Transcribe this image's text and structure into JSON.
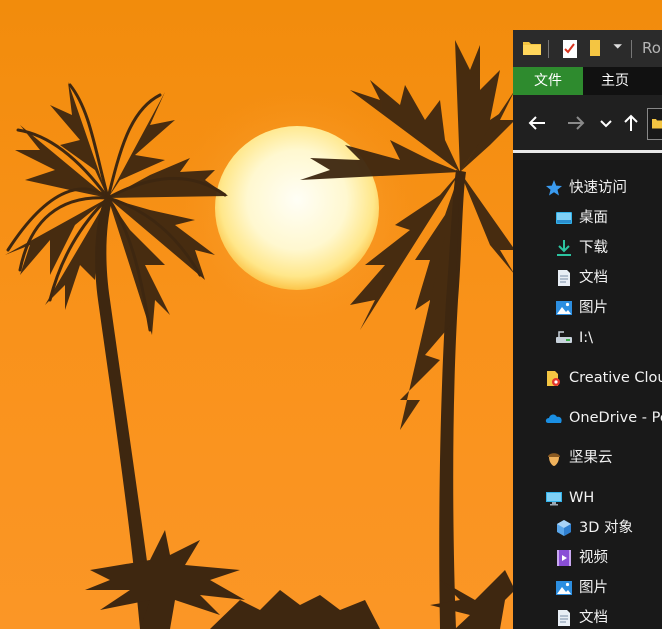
{
  "window": {
    "title_partial": "Ro"
  },
  "ribbon": {
    "tabs": [
      "文件",
      "主页"
    ]
  },
  "colors": {
    "sky_top": "#f28e0e",
    "sky_bottom": "#fb9322",
    "sun": "#fffbe8",
    "palms": "#402810",
    "explorer_bg": "#191919",
    "file_tab": "#2e8b2e"
  },
  "nav": {
    "icons": [
      "back-arrow-icon",
      "forward-arrow-icon",
      "recent-dropdown-icon",
      "up-arrow-icon",
      "folder-icon"
    ]
  },
  "tree": {
    "quick_access": {
      "label": "快速访问",
      "icon": "star-icon",
      "items": [
        {
          "label": "桌面",
          "icon": "desktop-icon"
        },
        {
          "label": "下载",
          "icon": "download-icon"
        },
        {
          "label": "文档",
          "icon": "document-icon"
        },
        {
          "label": "图片",
          "icon": "pictures-icon"
        },
        {
          "label": "I:\\",
          "icon": "network-drive-icon"
        }
      ]
    },
    "creative_cloud": {
      "label": "Creative Clou",
      "icon": "creative-cloud-folder-icon"
    },
    "onedrive": {
      "label": "OneDrive - Pe",
      "icon": "onedrive-cloud-icon"
    },
    "jianguoyun": {
      "label": "坚果云",
      "icon": "nut-icon"
    },
    "this_pc": {
      "label": "WH",
      "icon": "computer-icon",
      "items": [
        {
          "label": "3D 对象",
          "icon": "3d-objects-icon"
        },
        {
          "label": "视频",
          "icon": "video-icon"
        },
        {
          "label": "图片",
          "icon": "pictures-icon"
        },
        {
          "label": "文档",
          "icon": "document-icon"
        }
      ]
    }
  }
}
